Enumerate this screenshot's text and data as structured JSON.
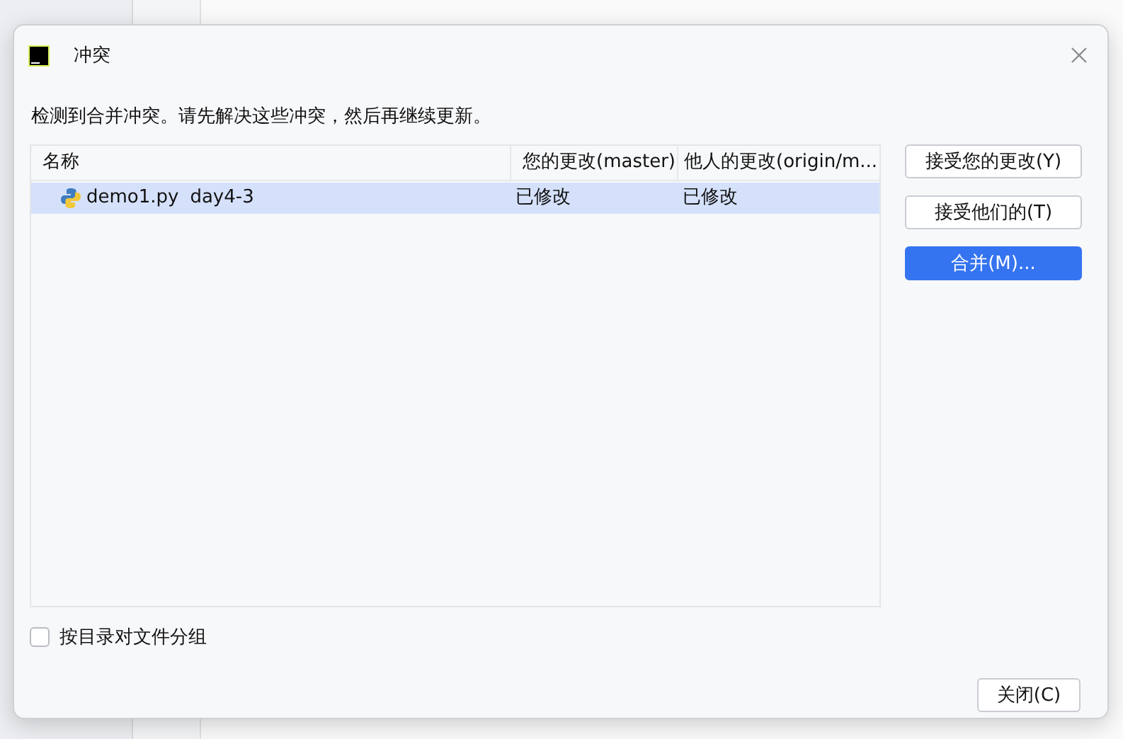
{
  "window": {
    "title": "冲突"
  },
  "message": "检测到合并冲突。请先解决这些冲突，然后再继续更新。",
  "table": {
    "columns": [
      "名称",
      "您的更改(master)",
      "他人的更改(origin/m..."
    ],
    "rows": [
      {
        "file": "demo1.py",
        "branch": "day4-3",
        "yours": "已修改",
        "theirs": "已修改",
        "selected": true
      }
    ]
  },
  "actions": [
    {
      "label": "接受您的更改(Y)",
      "primary": false
    },
    {
      "label": "接受他们的(T)",
      "primary": false
    },
    {
      "label": "合并(M)...",
      "primary": true
    }
  ],
  "group_by_directory": {
    "label": "按目录对文件分组",
    "checked": false
  },
  "close_button": "关闭(C)"
}
